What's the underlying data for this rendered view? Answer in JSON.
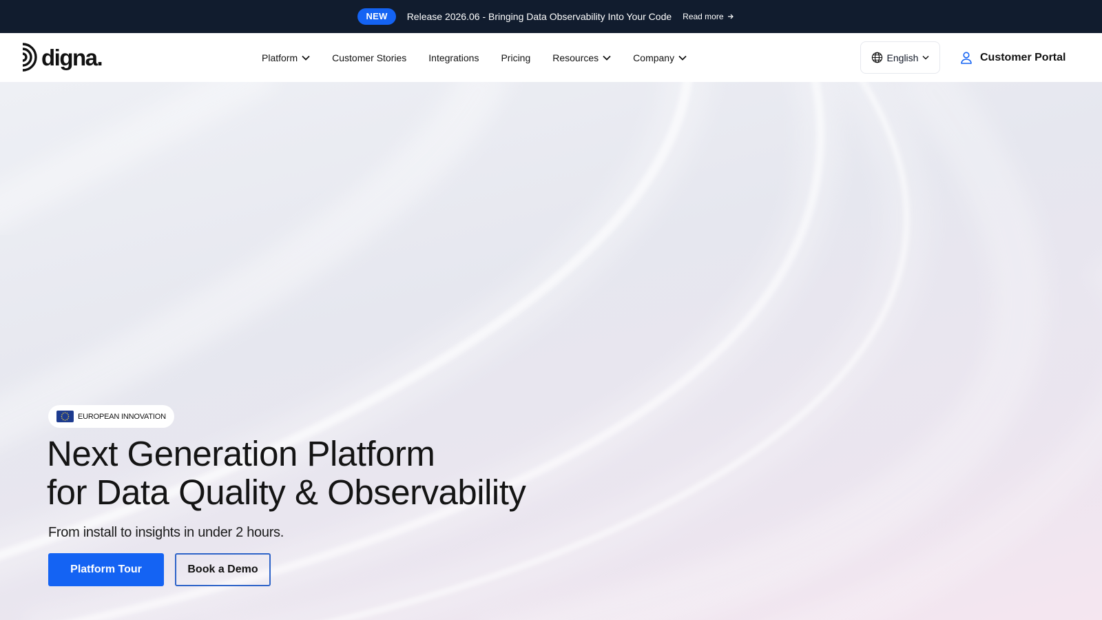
{
  "announcement": {
    "badge": "NEW",
    "text": "Release 2026.06 - Bringing Data Observability Into Your Code",
    "link_label": "Read more"
  },
  "header": {
    "logo_text": "digna.",
    "nav": [
      {
        "label": "Platform",
        "has_dropdown": true
      },
      {
        "label": "Customer Stories",
        "has_dropdown": false
      },
      {
        "label": "Integrations",
        "has_dropdown": false
      },
      {
        "label": "Pricing",
        "has_dropdown": false
      },
      {
        "label": "Resources",
        "has_dropdown": true
      },
      {
        "label": "Company",
        "has_dropdown": true
      }
    ],
    "language": "English",
    "portal_label": "Customer Portal"
  },
  "hero": {
    "badge": "EUROPEAN INNOVATION",
    "title_line1": "Next Generation Platform",
    "title_line2": "for Data Quality & Observability",
    "subtitle": "From install to insights in under 2 hours.",
    "primary_cta": "Platform Tour",
    "secondary_cta": "Book a Demo"
  },
  "colors": {
    "announcement_bg": "#111c2e",
    "accent_blue": "#1463f3",
    "outline_blue": "#2d63c8",
    "eu_flag_blue": "#1d3b8f",
    "eu_star_yellow": "#f3d23c"
  },
  "icons": {
    "read_more": "arrow-right-icon",
    "nav_dropdown": "chevron-down-icon",
    "language": "globe-icon",
    "portal": "user-icon",
    "badge": "eu-flag-icon",
    "logo": "digna-logo-mark"
  }
}
